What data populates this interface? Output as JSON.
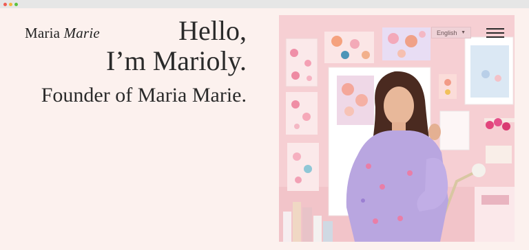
{
  "header": {
    "logo_regular": "Maria",
    "logo_italic": "Marie",
    "language": "English",
    "language_caret": "▼"
  },
  "hero": {
    "greeting": "Hello,",
    "name_line": "I’m Marioly.",
    "subtitle": "Founder of Maria Marie."
  },
  "icons": {
    "menu": "hamburger-icon",
    "language_caret": "caret-down-icon",
    "window_controls": [
      "close-dot",
      "minimize-dot",
      "maximize-dot"
    ]
  },
  "colors": {
    "background": "#fcf1ee",
    "text": "#2b2b2b",
    "photo_wall": "#f6cfd3",
    "dress": "#b9a6e0"
  }
}
